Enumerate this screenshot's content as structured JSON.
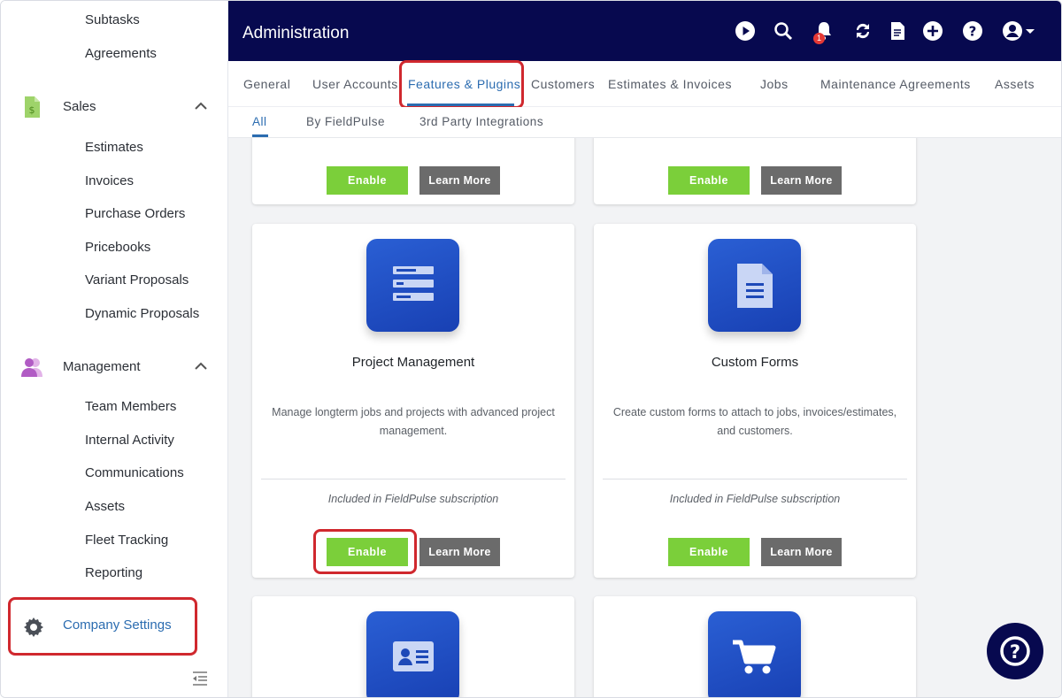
{
  "sidebar": {
    "items_top": [
      {
        "label": "Subtasks"
      },
      {
        "label": "Agreements"
      }
    ],
    "sales": {
      "label": "Sales",
      "icon": "sales-document-icon",
      "items": [
        "Estimates",
        "Invoices",
        "Purchase Orders",
        "Pricebooks",
        "Variant Proposals",
        "Dynamic Proposals"
      ]
    },
    "management": {
      "label": "Management",
      "icon": "people-icon",
      "items": [
        "Team Members",
        "Internal Activity",
        "Communications",
        "Assets",
        "Fleet Tracking",
        "Reporting"
      ]
    },
    "company_settings": {
      "label": "Company Settings",
      "icon": "gear-icon"
    }
  },
  "header": {
    "title": "Administration",
    "notification_count": "1",
    "icons": [
      "play-icon",
      "search-icon",
      "bell-icon",
      "sync-icon",
      "document-icon",
      "add-icon",
      "help-icon",
      "user-account-icon"
    ]
  },
  "tabs": [
    {
      "label": "General"
    },
    {
      "label": "User Accounts"
    },
    {
      "label": "Features & Plugins",
      "active": true
    },
    {
      "label": "Customers"
    },
    {
      "label": "Estimates & Invoices"
    },
    {
      "label": "Jobs"
    },
    {
      "label": "Maintenance Agreements"
    },
    {
      "label": "Assets"
    }
  ],
  "subtabs": [
    {
      "label": "All",
      "active": true
    },
    {
      "label": "By FieldPulse"
    },
    {
      "label": "3rd Party Integrations"
    }
  ],
  "cards": {
    "enable_label": "Enable",
    "learn_more_label": "Learn More",
    "project_management": {
      "title": "Project Management",
      "description": "Manage longterm jobs and projects with advanced project management.",
      "note": "Included in FieldPulse subscription",
      "icon": "list-icon"
    },
    "custom_forms": {
      "title": "Custom Forms",
      "description": "Create custom forms to attach to jobs, invoices/estimates, and customers.",
      "note": "Included in FieldPulse subscription",
      "icon": "form-document-icon"
    },
    "bottom_left_icon": "contact-card-icon",
    "bottom_right_icon": "cart-icon"
  },
  "colors": {
    "header_bg": "#07094f",
    "accent": "#2b6cb0",
    "enable_green": "#7bcf3a",
    "learn_gray": "#6b6b6b",
    "highlight_red": "#d0282e"
  }
}
